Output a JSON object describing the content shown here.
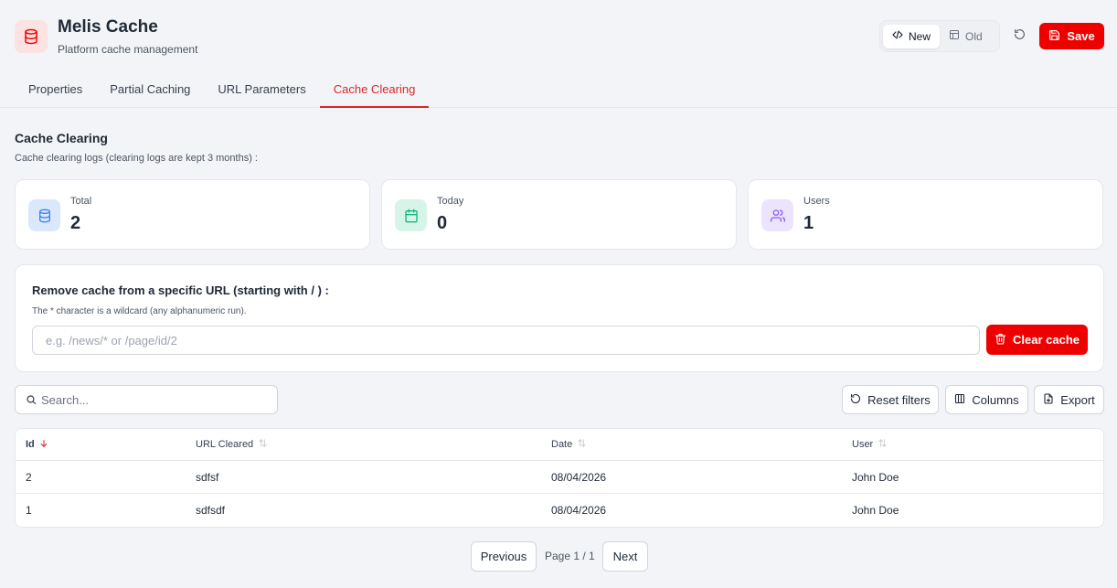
{
  "app": {
    "title": "Melis Cache",
    "subtitle": "Platform cache management"
  },
  "header": {
    "toggle": {
      "new_label": "New",
      "old_label": "Old",
      "selected": "New"
    },
    "save_label": "Save",
    "accent_color": "#ef0000"
  },
  "tabs": [
    {
      "label": "Properties"
    },
    {
      "label": "Partial Caching"
    },
    {
      "label": "URL Parameters"
    },
    {
      "label": "Cache Clearing"
    }
  ],
  "active_tab": "Cache Clearing",
  "section": {
    "title": "Cache Clearing",
    "subtitle": "Cache clearing logs (clearing logs are kept 3 months) :"
  },
  "stats": [
    {
      "label": "Total",
      "value": "2",
      "icon": "database-icon",
      "color": "#3b82f6"
    },
    {
      "label": "Today",
      "value": "0",
      "icon": "calendar-icon",
      "color": "#10b981"
    },
    {
      "label": "Users",
      "value": "1",
      "icon": "users-icon",
      "color": "#8b5cf6"
    }
  ],
  "clear_form": {
    "title": "Remove cache from a specific URL (starting with / ) :",
    "hint": "The * character is a wildcard (any alphanumeric run).",
    "placeholder": "e.g. /news/* or /page/id/2",
    "value": "",
    "button_label": "Clear cache"
  },
  "toolbar": {
    "search_placeholder": "Search...",
    "reset_filters_label": "Reset filters",
    "columns_label": "Columns",
    "export_label": "Export"
  },
  "table": {
    "columns": [
      {
        "label": "Id",
        "sort": "desc"
      },
      {
        "label": "URL Cleared",
        "sort": "none"
      },
      {
        "label": "Date",
        "sort": "none"
      },
      {
        "label": "User",
        "sort": "none"
      }
    ],
    "rows": [
      {
        "id": "2",
        "url": "sdfsf",
        "date": "08/04/2026",
        "user": "John Doe"
      },
      {
        "id": "1",
        "url": "sdfsdf",
        "date": "08/04/2026",
        "user": "John Doe"
      }
    ]
  },
  "pagination": {
    "previous_label": "Previous",
    "page_info": "Page 1 / 1",
    "next_label": "Next"
  }
}
